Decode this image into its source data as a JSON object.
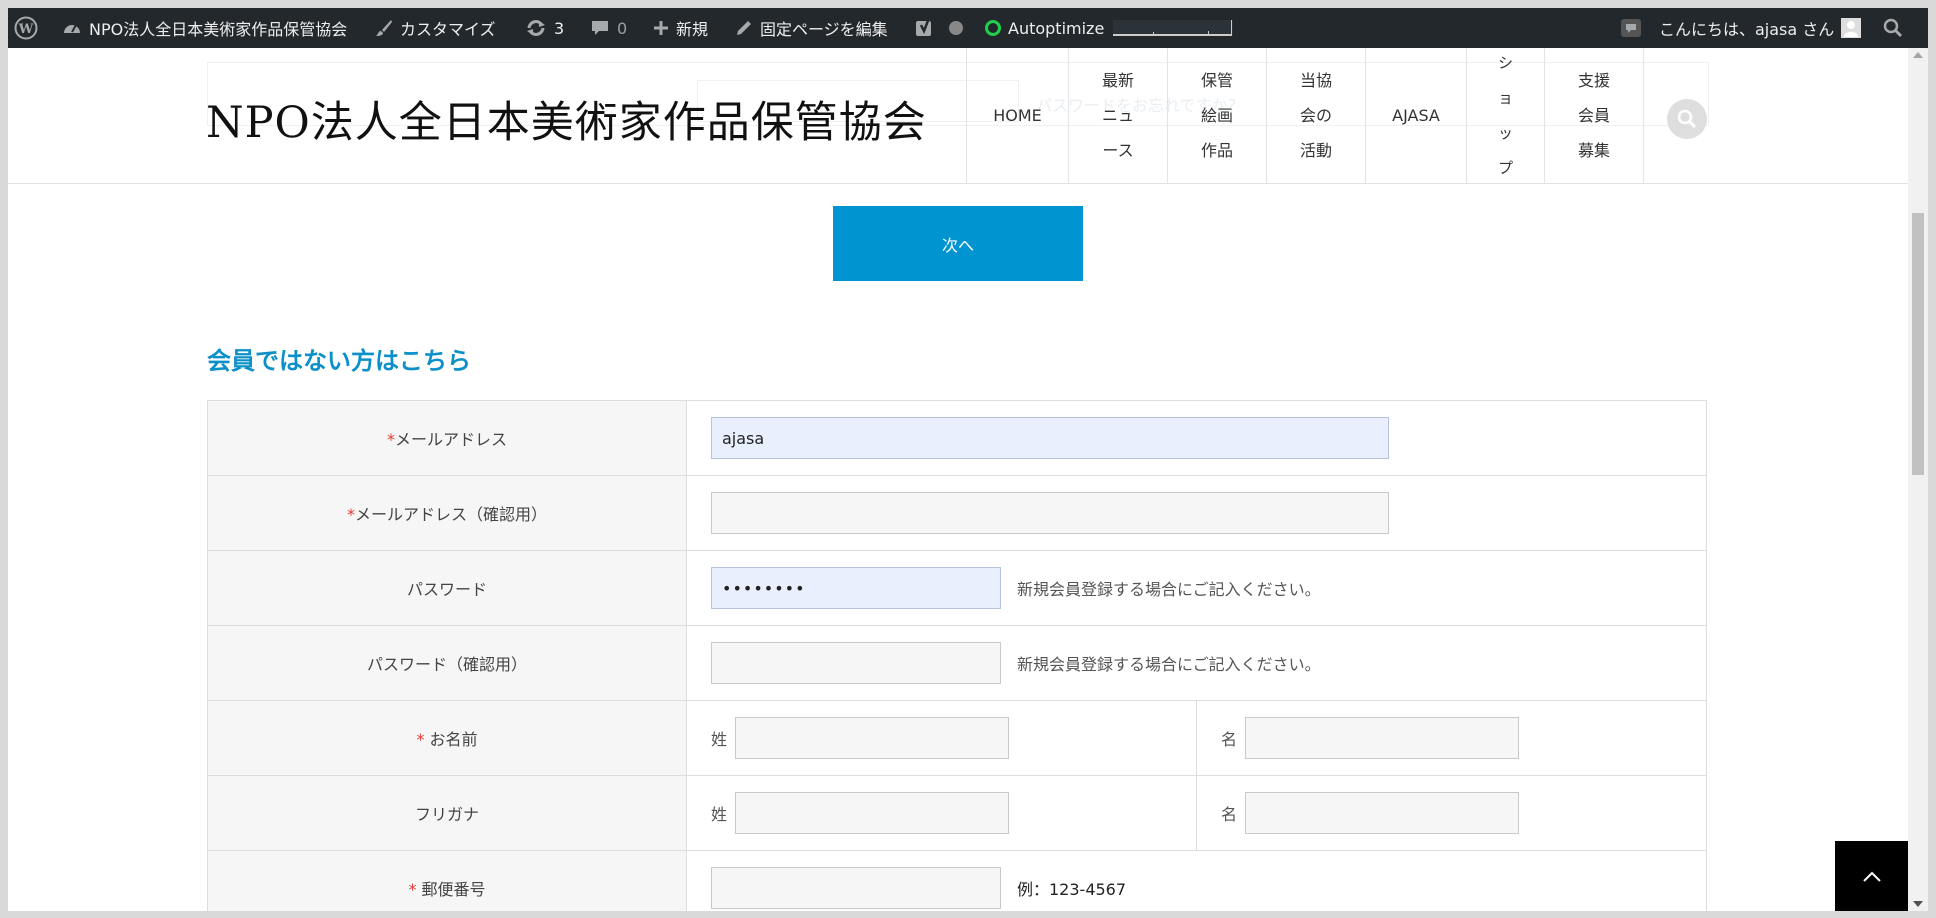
{
  "admin_bar": {
    "site_name": "NPO法人全日本美術家作品保管協会",
    "customize": "カスタマイズ",
    "updates_count": "3",
    "comments_count": "0",
    "new_label": "新規",
    "edit_page": "固定ページを編集",
    "autoptimize": "Autoptimize",
    "greeting": "こんにちは、ajasa さん"
  },
  "header": {
    "site_title": "NPO法人全日本美術家作品保管協会",
    "ghost_text": "パスワードをお忘れですか？",
    "nav": [
      {
        "label": "HOME"
      },
      {
        "label": "最新ニュース"
      },
      {
        "label": "保管絵画作品"
      },
      {
        "label": "当協会の活動"
      },
      {
        "label": "AJASA"
      },
      {
        "label": "ショップ"
      },
      {
        "label": "支援会員募集"
      }
    ]
  },
  "content": {
    "next_button": "次へ",
    "section_title": "会員ではない方はこちら"
  },
  "form": {
    "required_mark": "*",
    "email_label": "メールアドレス",
    "email_value": "ajasa",
    "email_confirm_label": "メールアドレス（確認用）",
    "email_confirm_value": "",
    "password_label": "パスワード",
    "password_value": "••••••••",
    "password_note": "新規会員登録する場合にご記入ください。",
    "password_confirm_label": "パスワード（確認用）",
    "password_confirm_value": "",
    "password_confirm_note": "新規会員登録する場合にご記入ください。",
    "name_label": "お名前",
    "sei_label": "姓",
    "mei_label": "名",
    "furigana_label": "フリガナ",
    "furi_sei_label": "姓",
    "furi_mei_label": "名",
    "zip_label": "郵便番号",
    "zip_example": "例：123-4567"
  },
  "colors": {
    "admin_bar_bg": "#23282d",
    "accent": "#0095d0",
    "section_title": "#0d90c8",
    "required": "#e53935"
  }
}
